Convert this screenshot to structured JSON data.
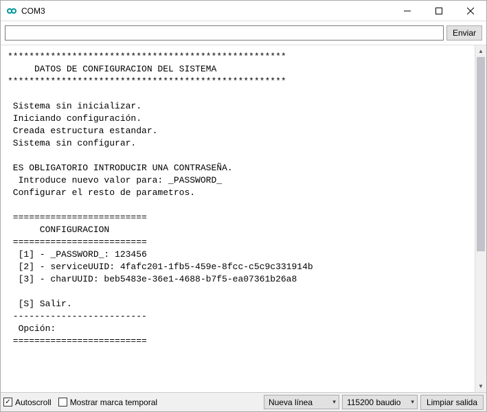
{
  "window": {
    "title": "COM3"
  },
  "input_row": {
    "value": "",
    "placeholder": "",
    "send_label": "Enviar"
  },
  "output": "****************************************************\n     DATOS DE CONFIGURACION DEL SISTEMA\n****************************************************\n\n Sistema sin inicializar.\n Iniciando configuración.\n Creada estructura estandar.\n Sistema sin configurar.\n\n ES OBLIGATORIO INTRODUCIR UNA CONTRASEÑA.\n  Introduce nuevo valor para: _PASSWORD_\n Configurar el resto de parametros.\n\n =========================\n      CONFIGURACION\n =========================\n  [1] - _PASSWORD_: 123456\n  [2] - serviceUUID: 4fafc201-1fb5-459e-8fcc-c5c9c331914b\n  [3] - charUUID: beb5483e-36e1-4688-b7f5-ea07361b26a8\n\n  [S] Salir.\n -------------------------\n  Opción:\n =========================",
  "footer": {
    "autoscroll_label": "Autoscroll",
    "autoscroll_checked": true,
    "timestamp_label": "Mostrar marca temporal",
    "timestamp_checked": false,
    "line_ending_selected": "Nueva línea",
    "baud_selected": "115200 baudio",
    "clear_label": "Limpiar salida"
  }
}
